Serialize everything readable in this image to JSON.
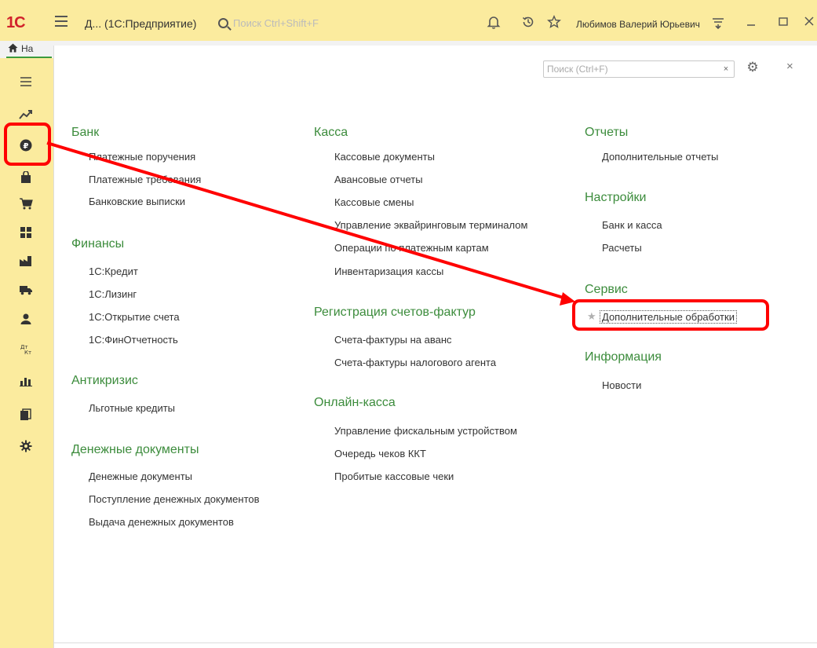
{
  "app": {
    "logo_text": "1С",
    "window_title": "Д... (1С:Предприятие)",
    "search_placeholder": "Поиск Ctrl+Shift+F",
    "user_name": "Любимов Валерий Юрьевич"
  },
  "tabs": {
    "home_label": "На"
  },
  "panel": {
    "search_placeholder": "Поиск (Ctrl+F)",
    "columns": [
      {
        "sections": [
          {
            "title": "Банк",
            "items": [
              "Платежные поручения",
              "Платежные требования",
              "Банковские выписки"
            ]
          },
          {
            "title": "Финансы",
            "items": [
              "1С:Кредит",
              "1С:Лизинг",
              "1С:Открытие счета",
              "1С:ФинОтчетность"
            ]
          },
          {
            "title": "Антикризис",
            "items": [
              "Льготные кредиты"
            ]
          },
          {
            "title": "Денежные документы",
            "items": [
              "Денежные документы",
              "Поступление денежных документов",
              "Выдача денежных документов"
            ]
          }
        ]
      },
      {
        "sections": [
          {
            "title": "Касса",
            "items": [
              "Кассовые документы",
              "Авансовые отчеты",
              "Кассовые смены",
              "Управление эквайринговым терминалом",
              "Операции по платежным картам",
              "Инвентаризация кассы"
            ]
          },
          {
            "title": "Регистрация счетов-фактур",
            "items": [
              "Счета-фактуры на аванс",
              "Счета-фактуры налогового агента"
            ]
          },
          {
            "title": "Онлайн-касса",
            "items": [
              "Управление фискальным устройством",
              "Очередь чеков ККТ",
              "Пробитые кассовые чеки"
            ]
          }
        ]
      },
      {
        "sections": [
          {
            "title": "Отчеты",
            "items": [
              "Дополнительные отчеты"
            ]
          },
          {
            "title": "Настройки",
            "items": [
              "Банк и касса",
              "Расчеты"
            ]
          },
          {
            "title": "Сервис",
            "items": [
              "Дополнительные обработки"
            ]
          },
          {
            "title": "Информация",
            "items": [
              "Новости"
            ]
          }
        ]
      }
    ]
  },
  "colors": {
    "accent_green": "#3c8c3c",
    "highlight_red": "#ff0000",
    "toolbar_yellow": "#fbeb9e"
  }
}
